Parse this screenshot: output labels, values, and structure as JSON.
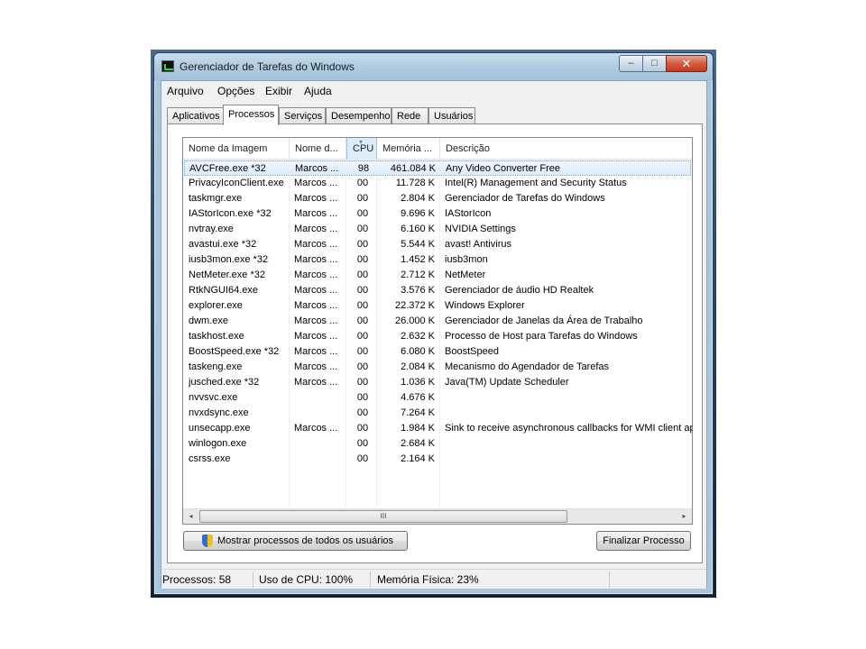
{
  "window": {
    "title": "Gerenciador de Tarefas do Windows",
    "minimize": "–",
    "maximize": "□",
    "close": "✕"
  },
  "menu": [
    "Arquivo",
    "Opções",
    "Exibir",
    "Ajuda"
  ],
  "tabs": [
    "Aplicativos",
    "Processos",
    "Serviços",
    "Desempenho",
    "Rede",
    "Usuários"
  ],
  "active_tab": "Processos",
  "columns": {
    "name": "Nome da Imagem",
    "user": "Nome d...",
    "cpu": "CPU",
    "memory": "Memória ...",
    "description": "Descrição"
  },
  "processes": [
    {
      "name": "AVCFree.exe *32",
      "user": "Marcos ...",
      "cpu": "98",
      "mem": "461.084 K",
      "desc": "Any Video Converter Free"
    },
    {
      "name": "PrivacyIconClient.exe",
      "user": "Marcos ...",
      "cpu": "00",
      "mem": "11.728 K",
      "desc": "Intel(R) Management and Security Status"
    },
    {
      "name": "taskmgr.exe",
      "user": "Marcos ...",
      "cpu": "00",
      "mem": "2.804 K",
      "desc": "Gerenciador de Tarefas do Windows"
    },
    {
      "name": "IAStorIcon.exe *32",
      "user": "Marcos ...",
      "cpu": "00",
      "mem": "9.696 K",
      "desc": "IAStorIcon"
    },
    {
      "name": "nvtray.exe",
      "user": "Marcos ...",
      "cpu": "00",
      "mem": "6.160 K",
      "desc": "NVIDIA Settings"
    },
    {
      "name": "avastui.exe *32",
      "user": "Marcos ...",
      "cpu": "00",
      "mem": "5.544 K",
      "desc": "avast! Antivirus"
    },
    {
      "name": "iusb3mon.exe *32",
      "user": "Marcos ...",
      "cpu": "00",
      "mem": "1.452 K",
      "desc": "iusb3mon"
    },
    {
      "name": "NetMeter.exe *32",
      "user": "Marcos ...",
      "cpu": "00",
      "mem": "2.712 K",
      "desc": "NetMeter"
    },
    {
      "name": "RtkNGUI64.exe",
      "user": "Marcos ...",
      "cpu": "00",
      "mem": "3.576 K",
      "desc": "Gerenciador de áudio HD Realtek"
    },
    {
      "name": "explorer.exe",
      "user": "Marcos ...",
      "cpu": "00",
      "mem": "22.372 K",
      "desc": "Windows Explorer"
    },
    {
      "name": "dwm.exe",
      "user": "Marcos ...",
      "cpu": "00",
      "mem": "26.000 K",
      "desc": "Gerenciador de Janelas da Área de Trabalho"
    },
    {
      "name": "taskhost.exe",
      "user": "Marcos ...",
      "cpu": "00",
      "mem": "2.632 K",
      "desc": "Processo de Host para Tarefas do Windows"
    },
    {
      "name": "BoostSpeed.exe *32",
      "user": "Marcos ...",
      "cpu": "00",
      "mem": "6.080 K",
      "desc": "BoostSpeed"
    },
    {
      "name": "taskeng.exe",
      "user": "Marcos ...",
      "cpu": "00",
      "mem": "2.084 K",
      "desc": "Mecanismo do Agendador de Tarefas"
    },
    {
      "name": "jusched.exe *32",
      "user": "Marcos ...",
      "cpu": "00",
      "mem": "1.036 K",
      "desc": "Java(TM) Update Scheduler"
    },
    {
      "name": "nvvsvc.exe",
      "user": "",
      "cpu": "00",
      "mem": "4.676 K",
      "desc": ""
    },
    {
      "name": "nvxdsync.exe",
      "user": "",
      "cpu": "00",
      "mem": "7.264 K",
      "desc": ""
    },
    {
      "name": "unsecapp.exe",
      "user": "Marcos ...",
      "cpu": "00",
      "mem": "1.984 K",
      "desc": "Sink to receive asynchronous callbacks for WMI client app"
    },
    {
      "name": "winlogon.exe",
      "user": "",
      "cpu": "00",
      "mem": "2.684 K",
      "desc": ""
    },
    {
      "name": "csrss.exe",
      "user": "",
      "cpu": "00",
      "mem": "2.164 K",
      "desc": ""
    }
  ],
  "scrollbar": {
    "left": "◂",
    "right": "▸",
    "grip": "III"
  },
  "buttons": {
    "show_all": "Mostrar processos de todos os usuários",
    "end_process": "Finalizar Processo"
  },
  "status": {
    "processes": "Processos: 58",
    "cpu": "Uso de CPU: 100%",
    "memory": "Memória Física: 23%"
  }
}
